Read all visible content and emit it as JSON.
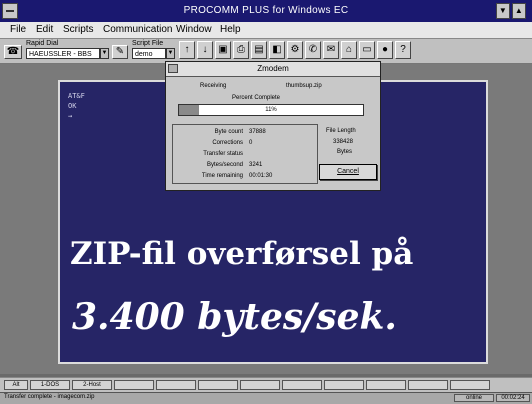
{
  "window": {
    "title": "PROCOMM PLUS for Windows EC"
  },
  "menubar": {
    "items": [
      "File",
      "Edit",
      "Scripts",
      "Communication",
      "Window",
      "Help"
    ]
  },
  "toolbar": {
    "dial_label": "Rapid Dial",
    "dial_value": "HAEUSSLER - BBS",
    "script_label": "Script File",
    "script_value": "demo"
  },
  "terminal": {
    "lines": [
      "AT&F",
      "OK",
      "→"
    ],
    "caption_line1": "ZIP-fil overførsel på",
    "caption_line2": "3.400 bytes/sek."
  },
  "zmodem": {
    "title": "Zmodem",
    "mode": "Receiving",
    "filename": "thumbsup.zip",
    "percent_label": "Percent Complete",
    "percent_text": "11%",
    "percent_value": 0.11,
    "stats": [
      {
        "label": "Byte count",
        "value": "37888"
      },
      {
        "label": "Corrections",
        "value": "0"
      },
      {
        "label": "Transfer status",
        "value": ""
      },
      {
        "label": "Bytes/second",
        "value": "3241"
      },
      {
        "label": "Time remaining",
        "value": "00:01:30"
      }
    ],
    "file_length_label": "File Length",
    "file_length_value": "338428",
    "file_length_unit": "Bytes",
    "cancel_label": "Cancel"
  },
  "fkeys": [
    "Alt",
    "1-DOS",
    "2-Host",
    "",
    "",
    "",
    "",
    "",
    "",
    "",
    "",
    ""
  ],
  "status": {
    "message": "Transfer complete - imagecom.zip",
    "online": "online",
    "clock": "00:02:24"
  }
}
